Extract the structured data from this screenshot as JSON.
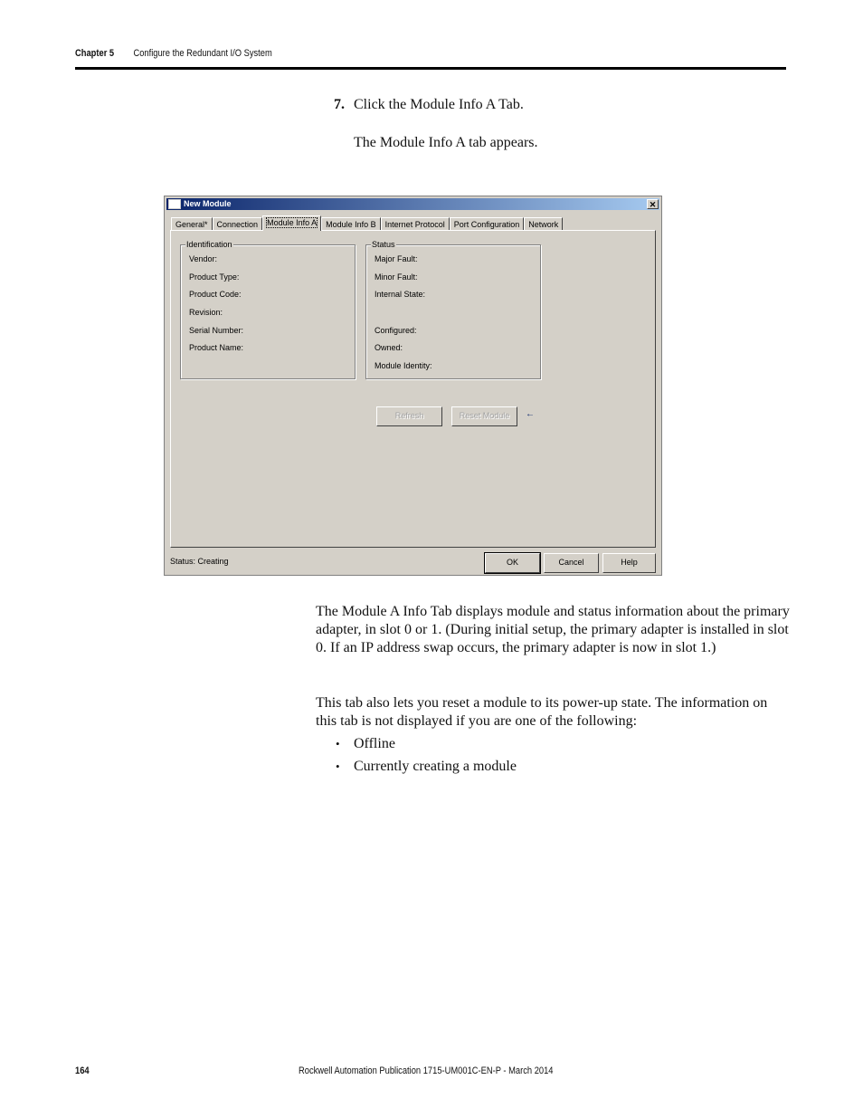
{
  "header": {
    "chapter": "Chapter 5",
    "title": "Configure the Redundant I/O System"
  },
  "step": {
    "number": "7.",
    "text": "Click the Module Info A Tab.",
    "result": "The Module Info A tab appears."
  },
  "dialog": {
    "title": "New Module",
    "close_label": "✕",
    "tabs": [
      {
        "label": "General*",
        "active": false
      },
      {
        "label": "Connection",
        "active": false
      },
      {
        "label": "Module Info A",
        "active": true
      },
      {
        "label": "Module Info B",
        "active": false
      },
      {
        "label": "Internet Protocol",
        "active": false
      },
      {
        "label": "Port Configuration",
        "active": false
      },
      {
        "label": "Network",
        "active": false
      }
    ],
    "identification": {
      "legend": "Identification",
      "fields": [
        "Vendor:",
        "Product Type:",
        "Product Code:",
        "Revision:",
        "Serial Number:",
        "Product Name:"
      ]
    },
    "status_group": {
      "legend": "Status",
      "fields": [
        "Major Fault:",
        "Minor Fault:",
        "Internal State:",
        "Configured:",
        "Owned:",
        "Module Identity:"
      ]
    },
    "buttons": {
      "refresh": "Refresh",
      "reset_module": "Reset Module",
      "ok": "OK",
      "cancel": "Cancel",
      "help": "Help"
    },
    "arrow_icon": "←",
    "status_text": "Status:  Creating"
  },
  "body": {
    "paragraph1": "The Module A Info Tab displays module and status information about the primary adapter, in slot 0 or 1. (During initial setup, the primary adapter is installed in slot 0. If an IP address swap occurs, the primary adapter is now in slot 1.)",
    "paragraph2": "This tab also lets you reset a module to its power-up state. The information on this tab is not displayed if you are one of the following:",
    "bullets": [
      "Offline",
      "Currently creating a module"
    ]
  },
  "footer": {
    "page_number": "164",
    "publication": "Rockwell Automation Publication 1715-UM001C-EN-P - March 2014"
  }
}
